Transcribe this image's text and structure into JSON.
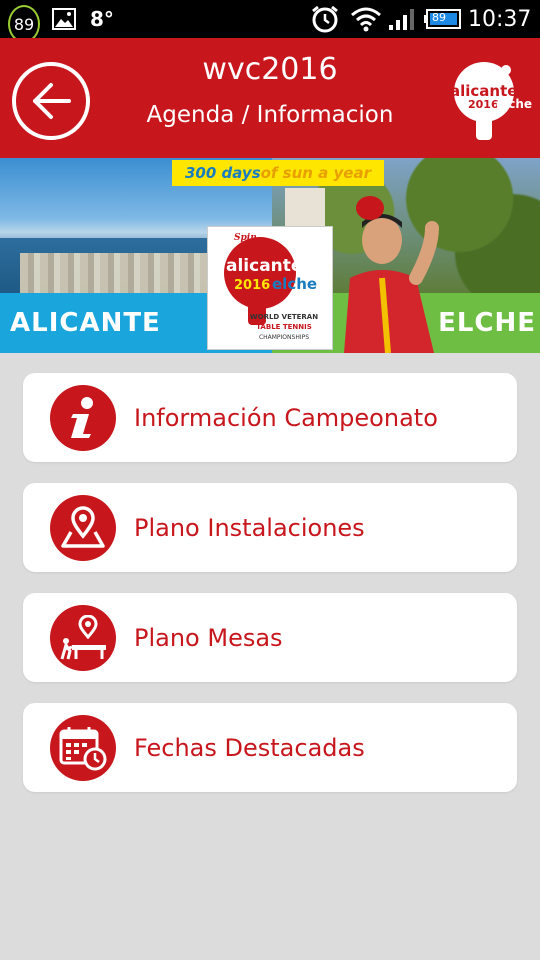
{
  "status_bar": {
    "notification_count": "89",
    "temperature": "8°",
    "battery_level": "89",
    "time": "10:37",
    "icons": [
      "notification-badge",
      "gallery-icon",
      "alarm-icon",
      "wifi-icon",
      "signal-icon",
      "battery-icon"
    ]
  },
  "header": {
    "title": "wvc2016",
    "subtitle": "Agenda / Informacion",
    "back_icon": "arrow-left-icon",
    "logo_text_top": "alicante",
    "logo_text_bottom": "2016 elche"
  },
  "banner": {
    "tagline_part1": "300 days ",
    "tagline_part2": "of sun a year",
    "left_city": "ALICANTE",
    "right_city": "ELCHE",
    "card": {
      "brand": "Spin",
      "line1": "alicante",
      "year": "2016",
      "line2": "elche",
      "line3": "WORLD VETERAN",
      "line4": "TABLE TENNIS",
      "line5": "CHAMPIONSHIPS"
    }
  },
  "menu": {
    "items": [
      {
        "label": "Información Campeonato",
        "icon": "info-icon"
      },
      {
        "label": "Plano Instalaciones",
        "icon": "map-pin-icon"
      },
      {
        "label": "Plano Mesas",
        "icon": "table-pin-icon"
      },
      {
        "label": "Fechas Destacadas",
        "icon": "calendar-icon"
      }
    ]
  },
  "colors": {
    "brand_red": "#c8161d",
    "background": "#dcdcdc",
    "alicante_blue": "#1aa6dc",
    "elche_green": "#6fbe44",
    "sun_yellow": "#ffe600"
  }
}
